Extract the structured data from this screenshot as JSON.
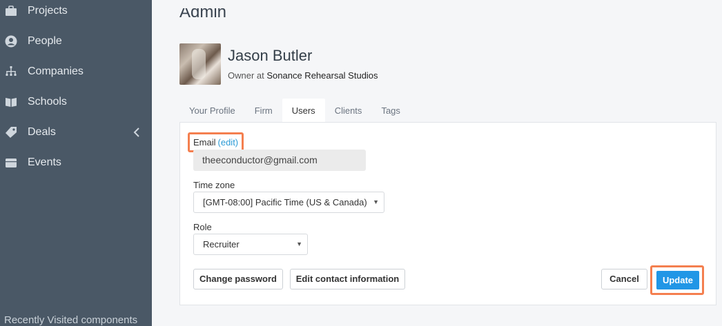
{
  "sidebar": {
    "items": [
      {
        "label": "Projects",
        "icon": "briefcase-icon"
      },
      {
        "label": "People",
        "icon": "person-icon"
      },
      {
        "label": "Companies",
        "icon": "org-chart-icon"
      },
      {
        "label": "Schools",
        "icon": "book-icon"
      },
      {
        "label": "Deals",
        "icon": "tag-icon"
      },
      {
        "label": "Events",
        "icon": "calendar-icon"
      }
    ],
    "bottom_text": "Recently Visited components"
  },
  "main": {
    "title": "Admin",
    "user": {
      "name": "Jason Butler",
      "role_prefix": "Owner at",
      "company": "Sonance Rehearsal Studios"
    },
    "tabs": [
      {
        "label": "Your Profile",
        "active": false
      },
      {
        "label": "Firm",
        "active": false
      },
      {
        "label": "Users",
        "active": true
      },
      {
        "label": "Clients",
        "active": false
      },
      {
        "label": "Tags",
        "active": false
      }
    ],
    "form": {
      "email_label": "Email",
      "email_edit": "(edit)",
      "email_value": "theeconductor@gmail.com",
      "timezone_label": "Time zone",
      "timezone_value": "[GMT-08:00] Pacific Time (US & Canada)",
      "role_label": "Role",
      "role_value": "Recruiter",
      "change_password": "Change password",
      "edit_contact": "Edit contact information",
      "cancel": "Cancel",
      "update": "Update"
    }
  },
  "colors": {
    "sidebar_bg": "#4a5866",
    "highlight": "#f47f4f",
    "primary": "#2196e6",
    "link": "#2b9bd6"
  }
}
